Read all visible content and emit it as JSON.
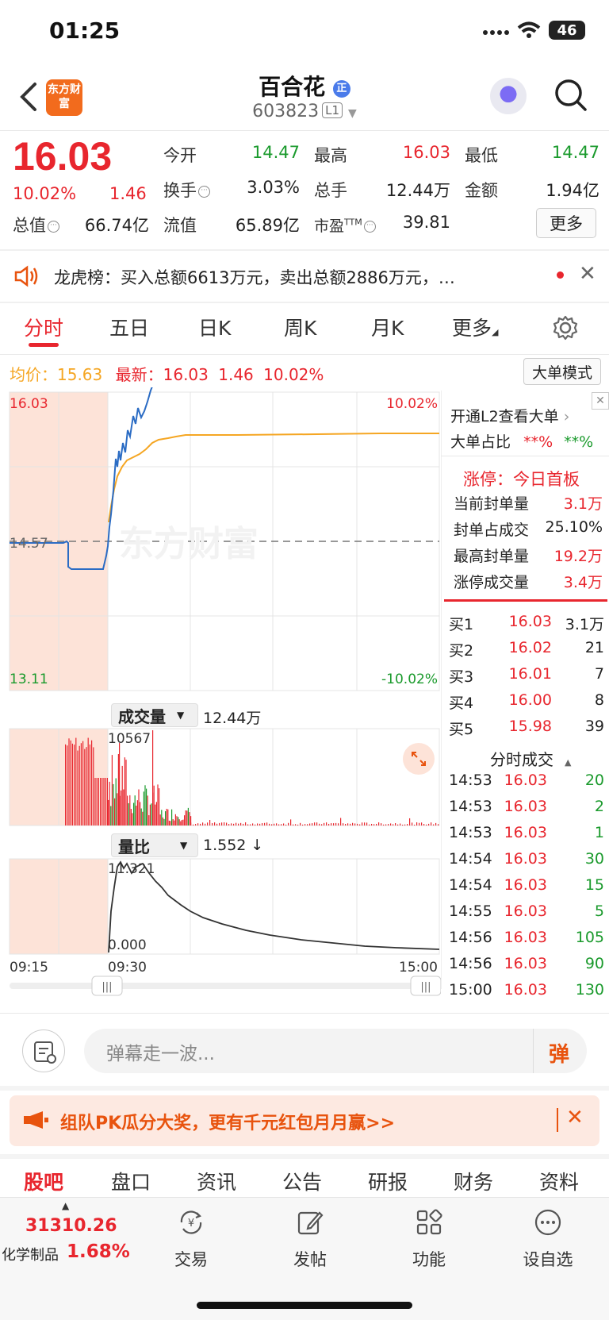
{
  "status": {
    "time": "01:25",
    "battery": "46"
  },
  "header": {
    "logo_text": "东方财富",
    "name": "百合花",
    "badge": "正",
    "code": "603823",
    "level": "L1"
  },
  "quote": {
    "price": "16.03",
    "pct": "10.02%",
    "change": "1.46",
    "fields": [
      {
        "label": "今开",
        "value": "14.47",
        "color": "green"
      },
      {
        "label": "最高",
        "value": "16.03",
        "color": "red"
      },
      {
        "label": "最低",
        "value": "14.47",
        "color": "green"
      },
      {
        "label": "换手",
        "value": "3.03%",
        "color": "black"
      },
      {
        "label": "总手",
        "value": "12.44万",
        "color": "black"
      },
      {
        "label": "金额",
        "value": "1.94亿",
        "color": "black"
      },
      {
        "label": "总值",
        "value": "66.74亿",
        "color": "black"
      },
      {
        "label": "流值",
        "value": "65.89亿",
        "color": "black"
      },
      {
        "label": "市盈",
        "value": "39.81",
        "color": "black"
      }
    ],
    "pe_superscript": "TTM",
    "more_label": "更多"
  },
  "ticker": {
    "text": "龙虎榜：买入总额6613万元，卖出总额2886万元，…"
  },
  "tabs": [
    "分时",
    "五日",
    "日K",
    "周K",
    "月K",
    "更多"
  ],
  "info_line": {
    "avg_label": "均价：",
    "avg_value": "15.63",
    "latest_label": "最新：",
    "latest_value": "16.03",
    "latest_change": "1.46",
    "latest_pct": "10.02%",
    "bigorder_label": "大单模式"
  },
  "chart_data": {
    "type": "line",
    "price_axis": {
      "top": "16.03",
      "mid": "14.57",
      "bottom": "13.11",
      "top_pct": "10.02%",
      "bottom_pct": "-10.02%"
    },
    "volume_label": "成交量",
    "volume_total": "12.44万",
    "volume_max": "10567",
    "ratio_label": "量比",
    "ratio_value": "1.552 ↓",
    "ratio_max": "11.321",
    "ratio_min": "0.000",
    "time_labels": [
      "09:15",
      "09:30",
      "15:00"
    ],
    "watermark": "东方财富",
    "colors": {
      "price": "#2b6cc4",
      "avg": "#f5a623",
      "up": "#e8262e",
      "down": "#1a9a2c"
    }
  },
  "right_panel": {
    "l2_title": "开通L2查看大单",
    "bigorder_ratio_label": "大单占比",
    "bigorder_ratio_red": "**%",
    "bigorder_ratio_green": "**%",
    "limit_title": "涨停：今日首板",
    "limit_rows": [
      {
        "label": "当前封单量",
        "value": "3.1万",
        "color": "red"
      },
      {
        "label": "封单占成交",
        "value": "25.10%",
        "color": "black"
      },
      {
        "label": "最高封单量",
        "value": "19.2万",
        "color": "red"
      },
      {
        "label": "涨停成交量",
        "value": "3.4万",
        "color": "red"
      }
    ],
    "order_book": [
      {
        "label": "买1",
        "price": "16.03",
        "vol": "3.1万"
      },
      {
        "label": "买2",
        "price": "16.02",
        "vol": "21"
      },
      {
        "label": "买3",
        "price": "16.01",
        "vol": "7"
      },
      {
        "label": "买4",
        "price": "16.00",
        "vol": "8"
      },
      {
        "label": "买5",
        "price": "15.98",
        "vol": "39"
      }
    ],
    "trades_title": "分时成交",
    "trades": [
      {
        "time": "14:53",
        "price": "16.03",
        "vol": "20"
      },
      {
        "time": "14:53",
        "price": "16.03",
        "vol": "2"
      },
      {
        "time": "14:53",
        "price": "16.03",
        "vol": "1"
      },
      {
        "time": "14:54",
        "price": "16.03",
        "vol": "30"
      },
      {
        "time": "14:54",
        "price": "16.03",
        "vol": "15"
      },
      {
        "time": "14:55",
        "price": "16.03",
        "vol": "5"
      },
      {
        "time": "14:56",
        "price": "16.03",
        "vol": "105"
      },
      {
        "time": "14:56",
        "price": "16.03",
        "vol": "90"
      },
      {
        "time": "15:00",
        "price": "16.03",
        "vol": "130"
      }
    ]
  },
  "comment": {
    "placeholder": "弹幕走一波...",
    "send_label": "弹"
  },
  "banner": {
    "text": "组队PK瓜分大奖，更有千元红包月月赢>>"
  },
  "bottom_tabs": [
    "股吧",
    "盘口",
    "资讯",
    "公告",
    "研报",
    "财务",
    "资料"
  ],
  "footer": {
    "index_value": "31310.26",
    "index_name": "化学制品",
    "index_pct": "1.68%",
    "buttons": [
      {
        "label": "交易",
        "icon": "yuan-exchange-icon"
      },
      {
        "label": "发帖",
        "icon": "edit-icon"
      },
      {
        "label": "功能",
        "icon": "grid-icon"
      },
      {
        "label": "设自选",
        "icon": "dots-circle-icon"
      }
    ]
  }
}
